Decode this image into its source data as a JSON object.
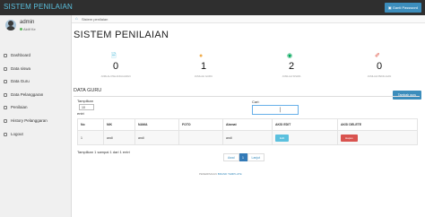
{
  "app": {
    "title": "SISTEM PENILAIAN",
    "top_button": "Ganti Password"
  },
  "user": {
    "name": "admin",
    "status": "Aktif  Ke"
  },
  "menu": [
    {
      "label": "Dashboard"
    },
    {
      "label": "Data siswa"
    },
    {
      "label": "Data Guru"
    },
    {
      "label": "Data Pelanggaran"
    },
    {
      "label": "Penilaian"
    },
    {
      "label": "History Pelanggaran"
    },
    {
      "label": "Logout"
    }
  ],
  "breadcrumb": {
    "current": "Sistem penilaian"
  },
  "page": {
    "title": "SISTEM PENILAIAN"
  },
  "stats": [
    {
      "value": "0",
      "label": "JUMLAH PELANGGARAN",
      "color": "#5bc0de"
    },
    {
      "value": "1",
      "label": "JUMLAH GURU",
      "color": "#f0ad4e"
    },
    {
      "value": "2",
      "label": "JUMLAH SISWA",
      "color": "#00a65a"
    },
    {
      "value": "0",
      "label": "JUMLAH PENILAIAN",
      "color": "#dd4b39"
    }
  ],
  "section": {
    "title": "DATA GURU",
    "add_button": "Tambah guru"
  },
  "table_controls": {
    "show_label": "Tampilkan",
    "show_value": "10",
    "entries_label": "entri",
    "search_label": "Cari:",
    "search_value": ""
  },
  "table": {
    "headers": [
      "No",
      "NIK",
      "NAMA",
      "FOTO",
      "Alamat",
      "AKSI EDIT",
      "AKSI DELETE"
    ],
    "rows": [
      {
        "no": "1",
        "nik": "andi",
        "nama": "andi",
        "foto": "",
        "alamat": "andi",
        "edit": "Edit",
        "delete": "Hapus"
      }
    ]
  },
  "table_info": "Tampilkan 1 sampai 1 dari 1 entri",
  "pagination": {
    "prev": "Awal",
    "current": "1",
    "next": "Lanjut"
  },
  "footer": {
    "text": "PENERIMAAN",
    "link": "BRAND TEMPLATE"
  }
}
